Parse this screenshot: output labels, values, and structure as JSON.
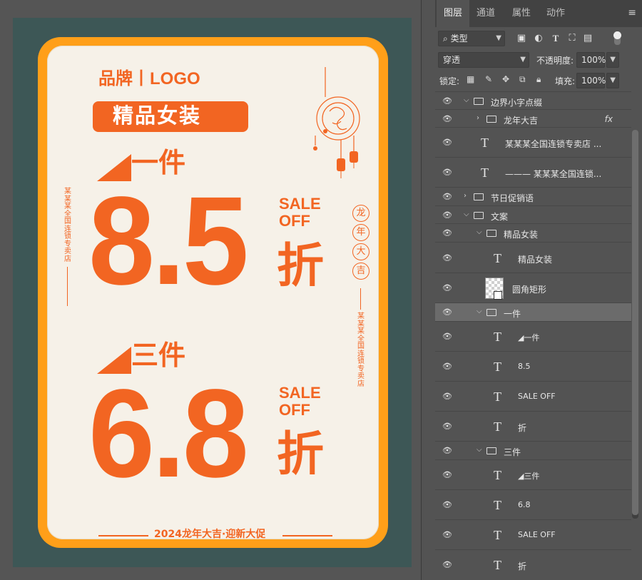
{
  "poster": {
    "brand": "品牌丨LOGO",
    "title": "精品女装",
    "offer1": {
      "label": "一件",
      "value": "8.5",
      "sale": [
        "SALE",
        "OFF"
      ],
      "unit": "折"
    },
    "offer2": {
      "label": "三件",
      "value": "6.8",
      "sale": [
        "SALE",
        "OFF"
      ],
      "unit": "折"
    },
    "vertical_left": "某某某全国连锁专卖店",
    "vertical_right": "某某某全国连锁专卖店",
    "seal": [
      "龙",
      "年",
      "大",
      "吉"
    ],
    "footer": "2024龙年大吉·迎新大促",
    "colors": {
      "accent": "#f26522",
      "frame": "#ff9f19",
      "paper": "#f6f1e8",
      "artboard": "#3d5756"
    }
  },
  "panel": {
    "tabs": [
      "图层",
      "通道",
      "属性",
      "动作"
    ],
    "active_tab": "图层",
    "filter_type": "类型",
    "blend_mode": "穿透",
    "opacity_label": "不透明度:",
    "opacity_value": "100%",
    "lock_label": "锁定:",
    "fill_label": "填充:",
    "fill_value": "100%",
    "layers": [
      {
        "name": "边界小字点缀",
        "kind": "group",
        "depth": 0,
        "open": true
      },
      {
        "name": "龙年大吉",
        "kind": "group",
        "depth": 1,
        "open": false,
        "fx": "fx"
      },
      {
        "name": "某某某全国连锁专卖店 ...",
        "kind": "text",
        "depth": 1
      },
      {
        "name": "——— 某某某全国连锁...",
        "kind": "text",
        "depth": 1
      },
      {
        "name": "节日促销语",
        "kind": "group",
        "depth": 0,
        "open": false
      },
      {
        "name": "文案",
        "kind": "group",
        "depth": 0,
        "open": true
      },
      {
        "name": "精品女装",
        "kind": "group",
        "depth": 1,
        "open": true
      },
      {
        "name": "精品女装",
        "kind": "text",
        "depth": 2
      },
      {
        "name": "圆角矩形",
        "kind": "shape",
        "depth": 2
      },
      {
        "name": "一件",
        "kind": "group",
        "depth": 1,
        "open": true,
        "selected": true
      },
      {
        "name": "◢一件",
        "kind": "text",
        "depth": 2
      },
      {
        "name": "8.5",
        "kind": "text",
        "depth": 2
      },
      {
        "name": "SALE OFF",
        "kind": "text",
        "depth": 2
      },
      {
        "name": "折",
        "kind": "text",
        "depth": 2
      },
      {
        "name": "三件",
        "kind": "group",
        "depth": 1,
        "open": true
      },
      {
        "name": "◢三件",
        "kind": "text",
        "depth": 2
      },
      {
        "name": "6.8",
        "kind": "text",
        "depth": 2
      },
      {
        "name": "SALE OFF",
        "kind": "text",
        "depth": 2
      },
      {
        "name": "折",
        "kind": "text",
        "depth": 2
      }
    ]
  }
}
